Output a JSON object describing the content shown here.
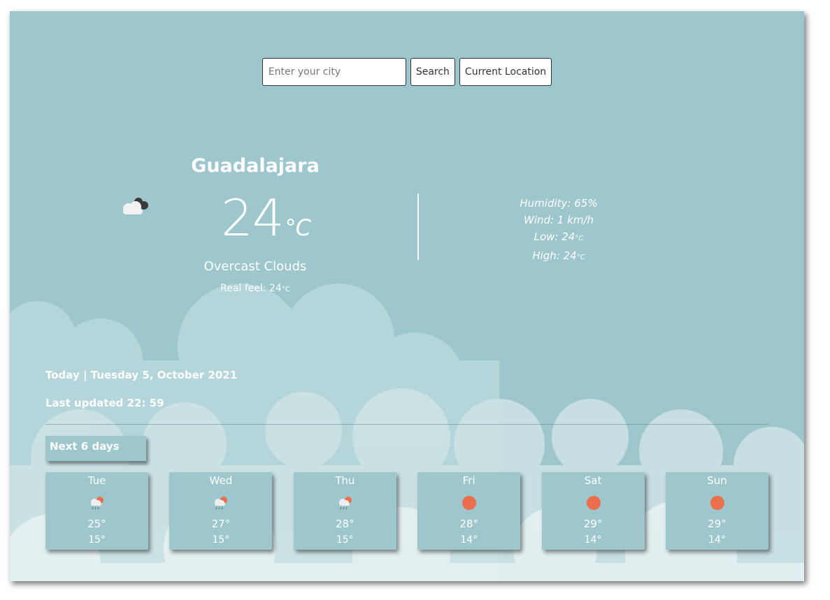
{
  "search": {
    "placeholder": "Enter your city",
    "value": "",
    "search_label": "Search",
    "location_label": "Current Location"
  },
  "current": {
    "city": "Guadalajara",
    "temperature": "24",
    "unit": "°C",
    "description": "Overcast Clouds",
    "real_feel_label": "Real feel: 24",
    "real_feel_unit": "°C",
    "icon": "overcast-clouds-icon"
  },
  "details": {
    "humidity": "Humidity: 65%",
    "wind": "Wind: 1 km/h",
    "low": "Low: 24",
    "high": "High: 24",
    "unit": "°C"
  },
  "meta": {
    "today": "Today | Tuesday 5, October 2021",
    "updated": "Last updated 22: 59"
  },
  "forecast": {
    "title": "Next 6 days",
    "days": [
      {
        "day": "Tue",
        "high": "25°",
        "low": "15°",
        "icon": "rain-sun-icon"
      },
      {
        "day": "Wed",
        "high": "27°",
        "low": "15°",
        "icon": "rain-sun-icon"
      },
      {
        "day": "Thu",
        "high": "28°",
        "low": "15°",
        "icon": "rain-sun-icon"
      },
      {
        "day": "Fri",
        "high": "28°",
        "low": "14°",
        "icon": "sun-icon"
      },
      {
        "day": "Sat",
        "high": "29°",
        "low": "14°",
        "icon": "sun-icon"
      },
      {
        "day": "Sun",
        "high": "29°",
        "low": "14°",
        "icon": "sun-icon"
      }
    ]
  },
  "colors": {
    "background": "#9dc6cd",
    "text": "#ffffff",
    "sun": "#ec6f4b"
  }
}
